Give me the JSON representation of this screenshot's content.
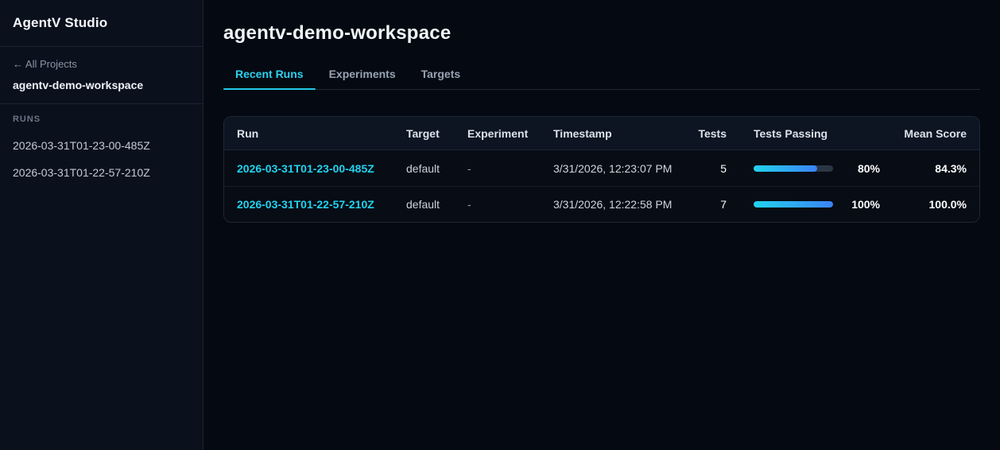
{
  "app": {
    "title": "AgentV Studio"
  },
  "sidebar": {
    "back_link": "← All Projects",
    "workspace_name": "agentv-demo-workspace",
    "runs_label": "RUNS",
    "runs": [
      "2026-03-31T01-23-00-485Z",
      "2026-03-31T01-22-57-210Z"
    ]
  },
  "main": {
    "title": "agentv-demo-workspace",
    "tabs": [
      {
        "label": "Recent Runs",
        "active": true
      },
      {
        "label": "Experiments",
        "active": false
      },
      {
        "label": "Targets",
        "active": false
      }
    ],
    "table": {
      "columns": [
        "Run",
        "Target",
        "Experiment",
        "Timestamp",
        "Tests",
        "Tests Passing",
        "Mean Score"
      ],
      "rows": [
        {
          "run": "2026-03-31T01-23-00-485Z",
          "target": "default",
          "experiment": "-",
          "timestamp": "3/31/2026, 12:23:07 PM",
          "tests": "5",
          "tests_passing_value": 80,
          "tests_passing_pct": "80%",
          "mean_score": "84.3%"
        },
        {
          "run": "2026-03-31T01-22-57-210Z",
          "target": "default",
          "experiment": "-",
          "timestamp": "3/31/2026, 12:22:58 PM",
          "tests": "7",
          "tests_passing_value": 100,
          "tests_passing_pct": "100%",
          "mean_score": "100.0%"
        }
      ]
    }
  },
  "colors": {
    "accent_cyan": "#22d3ee",
    "accent_blue": "#3b82f6",
    "sidebar_bg": "#0b101d",
    "main_bg": "#050a12",
    "card_header_bg": "#0e1522",
    "card_row_bg": "#070c15",
    "border": "#1e2736",
    "bar_track": "#2b3645"
  }
}
